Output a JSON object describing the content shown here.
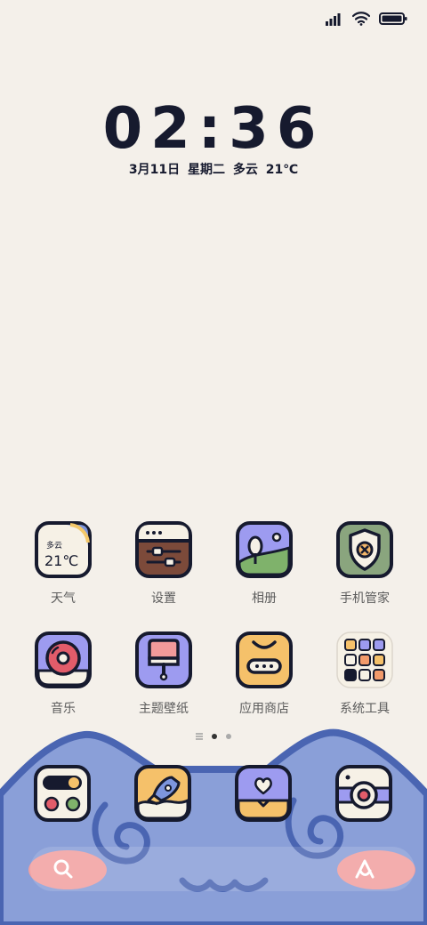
{
  "status_bar": {
    "icons": [
      "signal-icon",
      "wifi-icon",
      "battery-icon"
    ]
  },
  "clock": {
    "time": "02:36",
    "date_line": "3月11日 星期二 多云 21℃"
  },
  "weather_widget": {
    "condition": "多云",
    "temperature": "21℃"
  },
  "apps_row1": [
    {
      "label": "天气",
      "icon": "weather-icon"
    },
    {
      "label": "设置",
      "icon": "settings-icon"
    },
    {
      "label": "相册",
      "icon": "gallery-icon"
    },
    {
      "label": "手机管家",
      "icon": "security-icon"
    }
  ],
  "apps_row2": [
    {
      "label": "音乐",
      "icon": "music-icon"
    },
    {
      "label": "主题壁纸",
      "icon": "themes-icon"
    },
    {
      "label": "应用商店",
      "icon": "app-store-icon"
    },
    {
      "label": "系统工具",
      "icon": "folder-icon"
    }
  ],
  "page_indicator": {
    "pages": 2,
    "active": 1
  },
  "dock": [
    {
      "icon": "toggle-dots-icon"
    },
    {
      "icon": "rocket-icon"
    },
    {
      "icon": "heart-message-icon"
    },
    {
      "icon": "camera-icon"
    }
  ],
  "search_bar": {
    "left_icon": "search-icon",
    "right_icon": "assistant-icon"
  },
  "colors": {
    "background": "#f4f0ea",
    "ink": "#161a2e",
    "wallpaper_blue": "#8a9fd8",
    "wallpaper_line": "#4a65b2",
    "blush": "#f2a0a0"
  }
}
